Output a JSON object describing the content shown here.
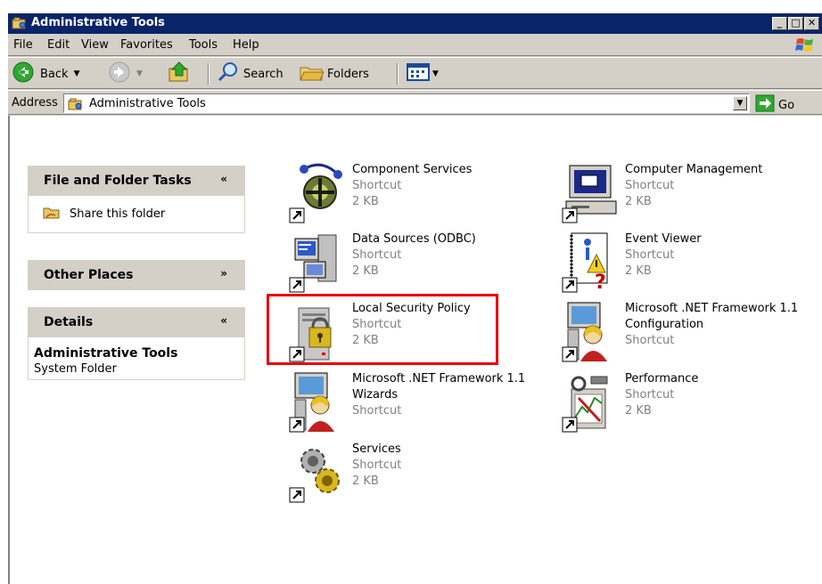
{
  "window": {
    "title": "Administrative Tools",
    "buttons": {
      "minimize": "_",
      "maximize": "□",
      "close": "✕"
    }
  },
  "menu": [
    "File",
    "Edit",
    "View",
    "Favorites",
    "Tools",
    "Help"
  ],
  "toolbar": {
    "back": "Back",
    "search": "Search",
    "folders": "Folders"
  },
  "address": {
    "label": "Address",
    "value": "Administrative Tools",
    "go": "Go"
  },
  "taskpane": {
    "file_tasks": {
      "title": "File and Folder Tasks",
      "chevron": "«",
      "items": [
        "Share this folder"
      ]
    },
    "other_places": {
      "title": "Other Places",
      "chevron": "»"
    },
    "details": {
      "title": "Details",
      "chevron": "«",
      "name": "Administrative Tools",
      "type": "System Folder"
    }
  },
  "items": [
    {
      "name": "Component Services",
      "line2": "Shortcut",
      "line3": "2 KB",
      "icon": "component-services-icon"
    },
    {
      "name": "Computer Management",
      "line2": "Shortcut",
      "line3": "2 KB",
      "icon": "computer-management-icon"
    },
    {
      "name": "Data Sources (ODBC)",
      "line2": "Shortcut",
      "line3": "2 KB",
      "icon": "data-sources-icon"
    },
    {
      "name": "Event Viewer",
      "line2": "Shortcut",
      "line3": "2 KB",
      "icon": "event-viewer-icon"
    },
    {
      "name": "Local Security Policy",
      "line2": "Shortcut",
      "line3": "2 KB",
      "icon": "local-security-policy-icon"
    },
    {
      "name": "Microsoft .NET Framework 1.1",
      "line2": "Configuration",
      "line3": "Shortcut",
      "icon": "dotnet-configuration-icon"
    },
    {
      "name": "Microsoft .NET Framework 1.1",
      "line2": "Wizards",
      "line3": "Shortcut",
      "icon": "dotnet-wizards-icon"
    },
    {
      "name": "Performance",
      "line2": "Shortcut",
      "line3": "2 KB",
      "icon": "performance-icon"
    },
    {
      "name": "Services",
      "line2": "Shortcut",
      "line3": "2 KB",
      "icon": "services-icon"
    }
  ],
  "colors": {
    "titlebar": "#0a246a",
    "face": "#d4d0c8",
    "highlight": "#e60000"
  }
}
